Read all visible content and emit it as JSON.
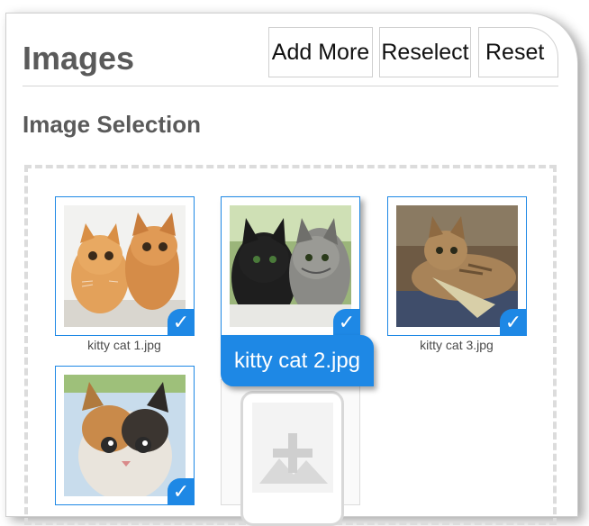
{
  "header": {
    "title": "Images",
    "buttons": {
      "add_more": "Add More",
      "reselect": "Reselect",
      "reset": "Reset"
    }
  },
  "section": {
    "title": "Image Selection"
  },
  "images": [
    {
      "caption": "kitty cat 1.jpg",
      "selected": true
    },
    {
      "caption": "kitty cat 2.jpg",
      "selected": true
    },
    {
      "caption": "kitty cat 3.jpg",
      "selected": true
    },
    {
      "caption": "",
      "selected": true
    }
  ],
  "tooltip": {
    "text": "kitty cat 2.jpg"
  },
  "check_glyph": "✓",
  "colors": {
    "accent": "#1e88e5",
    "title": "#5a5a5a"
  },
  "icons": {
    "check": "checkmark-icon",
    "add": "add-image-icon"
  }
}
